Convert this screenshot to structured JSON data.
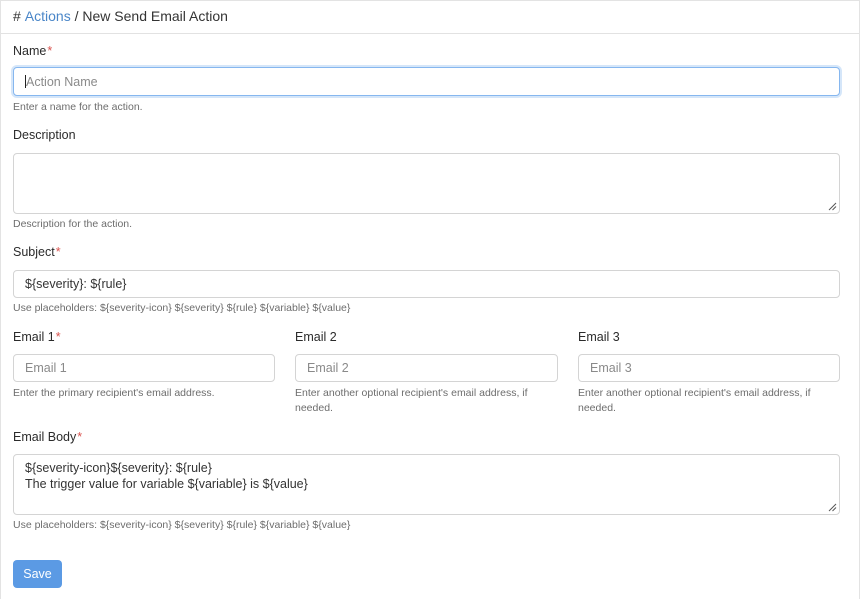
{
  "breadcrumb": {
    "hash": "#",
    "parent": "Actions",
    "separator": "/",
    "current": "New Send Email Action"
  },
  "form": {
    "required_mark": "*",
    "name": {
      "label": "Name",
      "placeholder": "Action Name",
      "value": "",
      "help": "Enter a name for the action."
    },
    "description": {
      "label": "Description",
      "value": "",
      "help": "Description for the action."
    },
    "subject": {
      "label": "Subject",
      "value": "${severity}: ${rule}",
      "help": "Use placeholders: ${severity-icon} ${severity} ${rule} ${variable} ${value}"
    },
    "email1": {
      "label": "Email 1",
      "placeholder": "Email 1",
      "help": "Enter the primary recipient's email address."
    },
    "email2": {
      "label": "Email 2",
      "placeholder": "Email 2",
      "help": "Enter another optional recipient's email address, if needed."
    },
    "email3": {
      "label": "Email 3",
      "placeholder": "Email 3",
      "help": "Enter another optional recipient's email address, if needed."
    },
    "body": {
      "label": "Email Body",
      "line1": "${severity-icon}${severity}: ${rule}",
      "line2": "The trigger value for variable ${variable} is ${value}",
      "help": "Use placeholders: ${severity-icon} ${severity} ${rule} ${variable} ${value}"
    },
    "save_label": "Save"
  },
  "colors": {
    "link": "#4a86c8",
    "required": "#d9534f",
    "primary_button": "#5b9ae4",
    "focus_border": "#86b7ef"
  }
}
